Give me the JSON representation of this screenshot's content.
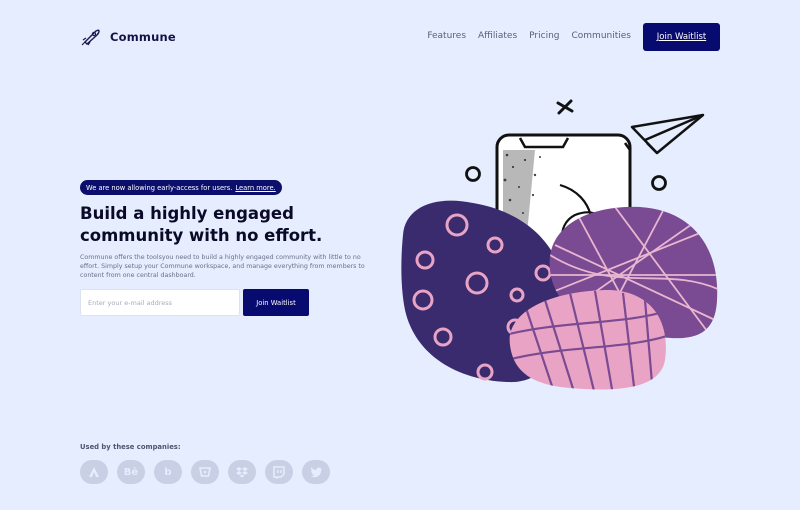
{
  "brand": {
    "name": "Commune",
    "icon": "rocket-icon"
  },
  "nav": {
    "links": [
      "Features",
      "Affiliates",
      "Pricing",
      "Communities"
    ],
    "cta": "Join Waitlist"
  },
  "hero": {
    "badge_text": "We are now allowing early-access for users.",
    "badge_link": "Learn more.",
    "headline": "Build a highly engaged community with no effort.",
    "subtext": "Commune offers the toolsyou need to build a highly engaged community with little to no effort. Simply setup your Commune workspace, and manage everything from members to content from one central dashboard.",
    "email_placeholder": "Enter your e-mail address",
    "cta": "Join Waitlist"
  },
  "companies": {
    "label": "Used by these companies:",
    "logos": [
      {
        "icon": "airbnb-icon",
        "glyph": ""
      },
      {
        "icon": "behance-icon",
        "glyph": "Bē"
      },
      {
        "icon": "bing-icon",
        "glyph": "b"
      },
      {
        "icon": "bitbucket-icon",
        "glyph": ""
      },
      {
        "icon": "dropbox-icon",
        "glyph": ""
      },
      {
        "icon": "twitch-icon",
        "glyph": ""
      },
      {
        "icon": "twitter-icon",
        "glyph": ""
      }
    ]
  },
  "colors": {
    "background": "#e6edfe",
    "primary": "#070a6e",
    "blob_dark": "#3a2a6e",
    "blob_purple": "#7a4a92",
    "blob_pink": "#e9a4c5"
  }
}
